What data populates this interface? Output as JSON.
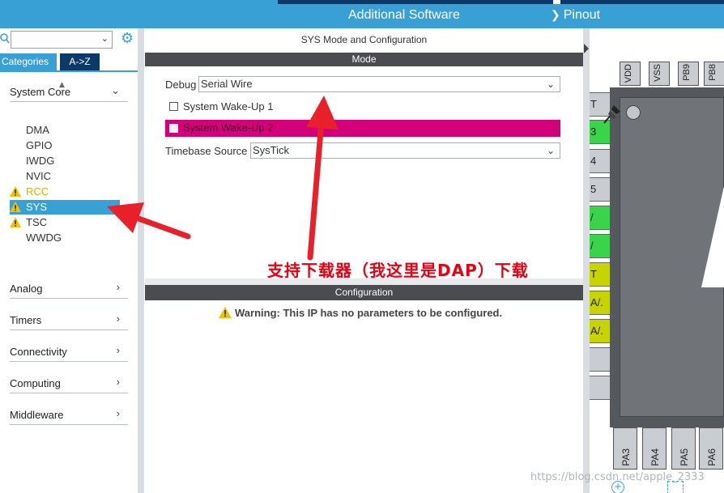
{
  "toolbar": {
    "additional_software": "Additional Software",
    "pinout": "Pinout"
  },
  "sidebar": {
    "tabs": {
      "categories": "Categories",
      "atoz": "A->Z"
    },
    "categories": [
      {
        "label": "System Core"
      },
      {
        "label": "Analog"
      },
      {
        "label": "Timers"
      },
      {
        "label": "Connectivity"
      },
      {
        "label": "Computing"
      },
      {
        "label": "Middleware"
      }
    ],
    "system_core_items": [
      {
        "label": "DMA",
        "warning": false
      },
      {
        "label": "GPIO",
        "warning": false
      },
      {
        "label": "IWDG",
        "warning": false
      },
      {
        "label": "NVIC",
        "warning": false
      },
      {
        "label": "RCC",
        "warning": true
      },
      {
        "label": "SYS",
        "warning": true,
        "selected": true
      },
      {
        "label": "TSC",
        "warning": true
      },
      {
        "label": "WWDG",
        "warning": false
      }
    ]
  },
  "main": {
    "title": "SYS Mode and Configuration",
    "mode_header": "Mode",
    "debug_label": "Debug",
    "debug_value": "Serial Wire",
    "wakeup1_label": "System Wake-Up 1",
    "wakeup2_label": "System Wake-Up 2",
    "timebase_label": "Timebase Source",
    "timebase_value": "SysTick",
    "config_header": "Configuration",
    "warning_text": "Warning: This IP has no parameters to be configured."
  },
  "annotation": {
    "text": "支持下载器（我这里是DAP）下载",
    "color": "#e60012"
  },
  "chip": {
    "top_pins": [
      "VDD",
      "VSS",
      "PB9",
      "PB8"
    ],
    "left_pins": [
      {
        "label": "T",
        "color": "grey"
      },
      {
        "label": "3",
        "color": "green"
      },
      {
        "label": "4",
        "color": "grey"
      },
      {
        "label": "5",
        "color": "grey"
      },
      {
        "label": "/",
        "color": "green"
      },
      {
        "label": "/",
        "color": "green"
      },
      {
        "label": "T",
        "color": "olive"
      },
      {
        "label": "A/.",
        "color": "olive"
      },
      {
        "label": "A/.",
        "color": "olive"
      },
      {
        "label": "",
        "color": "grey"
      },
      {
        "label": "",
        "color": "grey"
      }
    ],
    "bottom_pins": [
      "PA3",
      "PA4",
      "PA5",
      "PA6"
    ]
  },
  "watermark": "https://blog.csdn.net/apple_2333",
  "colors": {
    "accent": "#39a0d6",
    "dark_tab": "#0b3a6a",
    "highlight_row": "#d4007a",
    "pin_green": "#39d44a",
    "pin_olive": "#c8d400",
    "warning": "#f5c000"
  }
}
